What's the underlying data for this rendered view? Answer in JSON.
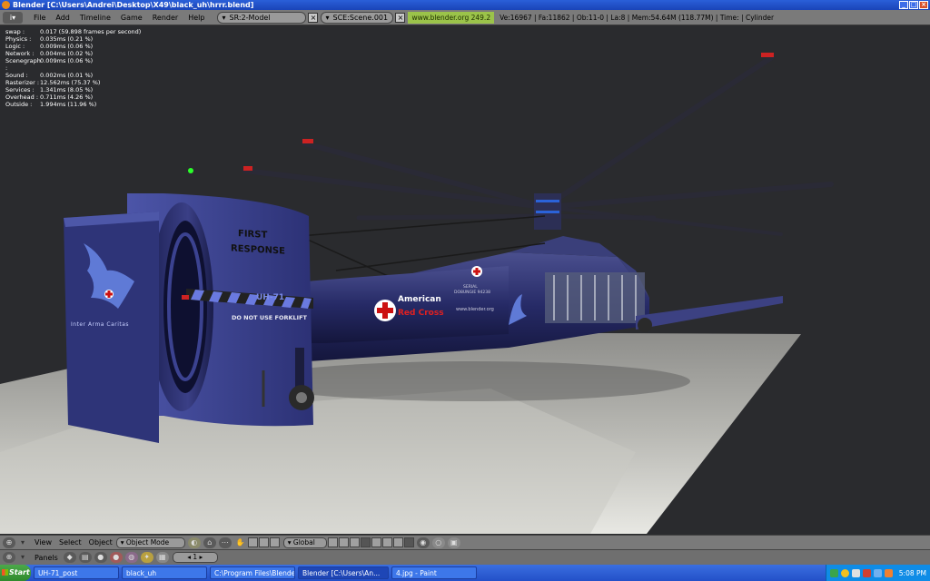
{
  "window": {
    "title": "Blender [C:\\Users\\Andrei\\Desktop\\X49\\black_uh\\hrrr.blend]",
    "buttons": [
      "_",
      "□",
      "×"
    ]
  },
  "header": {
    "menus": [
      "File",
      "Add",
      "Timeline",
      "Game",
      "Render",
      "Help"
    ],
    "screen": "SR:2-Model",
    "scene": "SCE:Scene.001",
    "url": "www.blender.org 249.2",
    "stats": "Ve:16967 | Fa:11862 | Ob:11-0 | La:8 | Mem:54.64M (118.77M) | Time: | Cylinder"
  },
  "profiler": [
    {
      "k": "swap :",
      "v": "0.017 (59.898 frames per second)"
    },
    {
      "k": "Physics :",
      "v": "0.035ms (0.21 %)"
    },
    {
      "k": "Logic :",
      "v": "0.009ms (0.06 %)"
    },
    {
      "k": "Network :",
      "v": "0.004ms (0.02 %)"
    },
    {
      "k": "Scenegraph :",
      "v": "0.009ms (0.06 %)"
    },
    {
      "k": "Sound :",
      "v": "0.002ms (0.01 %)"
    },
    {
      "k": "Rasterizer :",
      "v": "12.562ms (75.37 %)"
    },
    {
      "k": "Services :",
      "v": "1.341ms (8.05 %)"
    },
    {
      "k": "Overhead :",
      "v": "0.711ms (4.26 %)"
    },
    {
      "k": "Outside :",
      "v": "1.994ms (11.96 %)"
    }
  ],
  "helicopter": {
    "fan_text_1": "FIRST",
    "fan_text_2": "RESPONSE",
    "motto": "Inter Arma Caritas",
    "tail_code": "UH-71",
    "warning": "DO NOT USE FORKLIFT",
    "org_1": "American",
    "org_2": "Red Cross",
    "site": "www.blender.org",
    "small_1": "SERIAL",
    "small_2": "DO8UNGIE 94238"
  },
  "viewheader": {
    "menus": [
      "View",
      "Select",
      "Object"
    ],
    "mode": "Object Mode",
    "orientation": "Global"
  },
  "panelheader": {
    "label": "Panels",
    "frame": "1"
  },
  "taskbar": {
    "start": "Start",
    "tasks": [
      "UH-71_post",
      "black_uh",
      "C:\\Program Files\\Blender...",
      "Blender [C:\\Users\\An...",
      "4.jpg - Paint"
    ],
    "clock": "5:08 PM"
  }
}
